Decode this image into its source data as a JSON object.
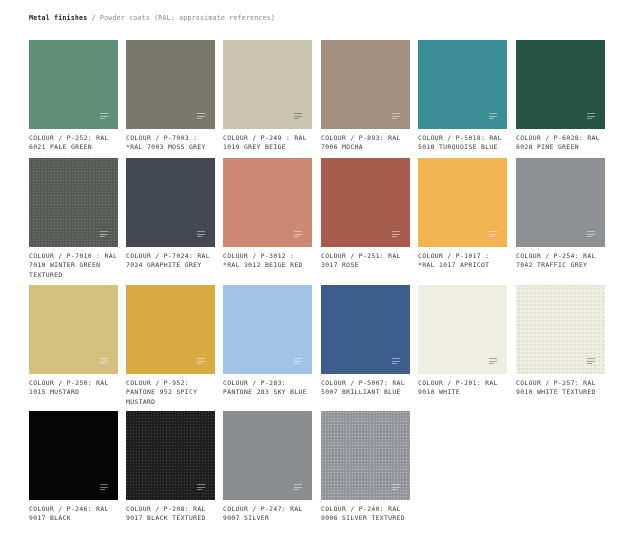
{
  "breadcrumb": {
    "section": "Metal finishes",
    "separator": "/",
    "current": "Powder coats (RAL: approximate references)"
  },
  "swatches": [
    {
      "label": "COLOUR / P-252: RAL 6021 PALE GREEN",
      "color": "#5e9077",
      "icon": "menu-icon"
    },
    {
      "label": "COLOUR / P-7003 : *RAL 7003 MOSS GREY",
      "color": "#7b7a6a",
      "icon": "menu-icon"
    },
    {
      "label": "COLOUR / P-249 : RAL 1019 GREY BEIGE",
      "color": "#cbc5b0",
      "icon": "menu-icon"
    },
    {
      "label": "COLOUR / P-893: RAL 7006 MOCHA",
      "color": "#a38f80",
      "icon": "menu-icon"
    },
    {
      "label": "COLOUR / P-5018: RAL 5018 TURQUOISE BLUE",
      "color": "#3a8d95",
      "icon": "menu-icon"
    },
    {
      "label": "COLOUR / P-6028: RAL 6028 PINE GREEN",
      "color": "#275545",
      "icon": "menu-icon"
    },
    {
      "label": "COLOUR / P-7010 : RAL 7010 WINTER GREEN TEXTURED",
      "color": "#595b57",
      "icon": "menu-icon"
    },
    {
      "label": "COLOUR / P-7024: RAL 7024 GRAPHITE GREY",
      "color": "#444852",
      "icon": "menu-icon"
    },
    {
      "label": "COLOUR / P-3012 : *RAL 3012 BEIGE RED",
      "color": "#cc8872",
      "icon": "menu-icon"
    },
    {
      "label": "COLOUR / P-251: RAL 3017 ROSE",
      "color": "#a65d4d",
      "icon": "menu-icon"
    },
    {
      "label": "COLOUR / P-1017 : *RAL 1017 APRICOT",
      "color": "#f1b451",
      "icon": "menu-icon"
    },
    {
      "label": "COLOUR / P-254: RAL 7042 TRAFFIC GREY",
      "color": "#8d9193",
      "icon": "menu-icon"
    },
    {
      "label": "COLOUR / P-250: RAL 1015 MUSTARD",
      "color": "#d4c180",
      "icon": "menu-icon"
    },
    {
      "label": "COLOUR / P-952: PANTONE 952 SPICY MUSTARD",
      "color": "#d7aa42",
      "icon": "menu-icon"
    },
    {
      "label": "COLOUR / P-283: PANTONE 283 SKY BLUE",
      "color": "#a3c3e9",
      "icon": "menu-icon"
    },
    {
      "label": "COLOUR / P-5007: RAL 5007 BRILLIANT BLUE",
      "color": "#3d5d8c",
      "icon": "menu-icon"
    },
    {
      "label": "COLOUR / P-201: RAL 9010 WHITE",
      "color": "#eeeee2",
      "icon": "menu-icon"
    },
    {
      "label": "COLOUR / P-257: RAL 9010 WHITE TEXTURED",
      "color": "#ededdf",
      "icon": "menu-icon"
    },
    {
      "label": "COLOUR / P-246: RAL 9017 BLACK",
      "color": "#050505",
      "icon": "menu-icon"
    },
    {
      "label": "COLOUR / P-208: RAL 9017 BLACK TEXTURED",
      "color": "#1e1e1e",
      "icon": "menu-icon"
    },
    {
      "label": "COLOUR / P-247: RAL 9007 SILVER",
      "color": "#8b8e90",
      "icon": "menu-icon"
    },
    {
      "label": "COLOUR / P-240: RAL 9006 SILVER TEXTURED",
      "color": "#95999e",
      "icon": "menu-icon"
    }
  ]
}
